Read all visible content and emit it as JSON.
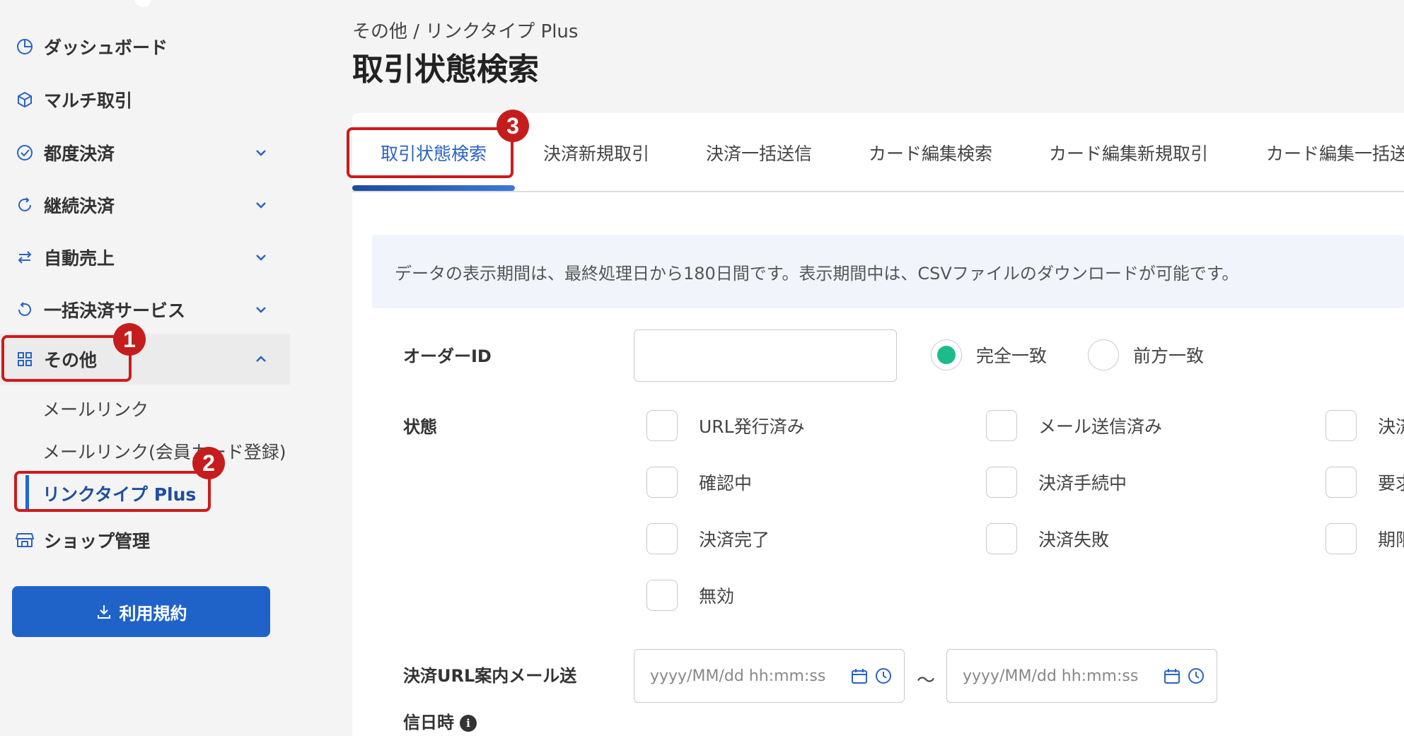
{
  "breadcrumb": "その他 / リンクタイプ Plus",
  "page_title": "取引状態検索",
  "sidebar": {
    "items": [
      {
        "label": "ダッシュボード",
        "icon": "dashboard-icon"
      },
      {
        "label": "マルチ取引",
        "icon": "cube-icon"
      },
      {
        "label": "都度決済",
        "icon": "check-circle-icon"
      },
      {
        "label": "継続決済",
        "icon": "refresh-icon"
      },
      {
        "label": "自動売上",
        "icon": "exchange-icon"
      },
      {
        "label": "一括決済サービス",
        "icon": "undo-icon"
      },
      {
        "label": "その他",
        "icon": "grid-icon"
      },
      {
        "label": "ショップ管理",
        "icon": "shop-icon"
      }
    ],
    "sub_items": [
      "メールリンク",
      "メールリンク(会員カード登録)",
      "リンクタイプ Plus"
    ],
    "terms_button": "利用規約"
  },
  "callouts": [
    "1",
    "2",
    "3"
  ],
  "tabs": [
    "取引状態検索",
    "決済新規取引",
    "決済一括送信",
    "カード編集検索",
    "カード編集新規取引",
    "カード編集一括送"
  ],
  "info_text": "データの表示期間は、最終処理日から180日間です。表示期間中は、CSVファイルのダウンロードが可能です。",
  "form": {
    "order_id_label": "オーダーID",
    "order_id_value": "",
    "match_options": [
      "完全一致",
      "前方一致"
    ],
    "match_selected": "完全一致",
    "status_label": "状態",
    "status_col1": [
      "URL発行済み",
      "確認中",
      "決済完了",
      "無効"
    ],
    "status_col2": [
      "メール送信済み",
      "決済手続中",
      "決済失敗"
    ],
    "status_col3": [
      "決済",
      "要求",
      "期限"
    ],
    "mail_date_label_line1": "決済URL案内メール送",
    "mail_date_label_line2": "信日時",
    "date_placeholder": "yyyy/MM/dd hh:mm:ss",
    "range_separator": "～"
  },
  "colors": {
    "primary": "#1f63c8",
    "accent_green": "#1fba8a",
    "callout_red": "#c51d1d"
  }
}
